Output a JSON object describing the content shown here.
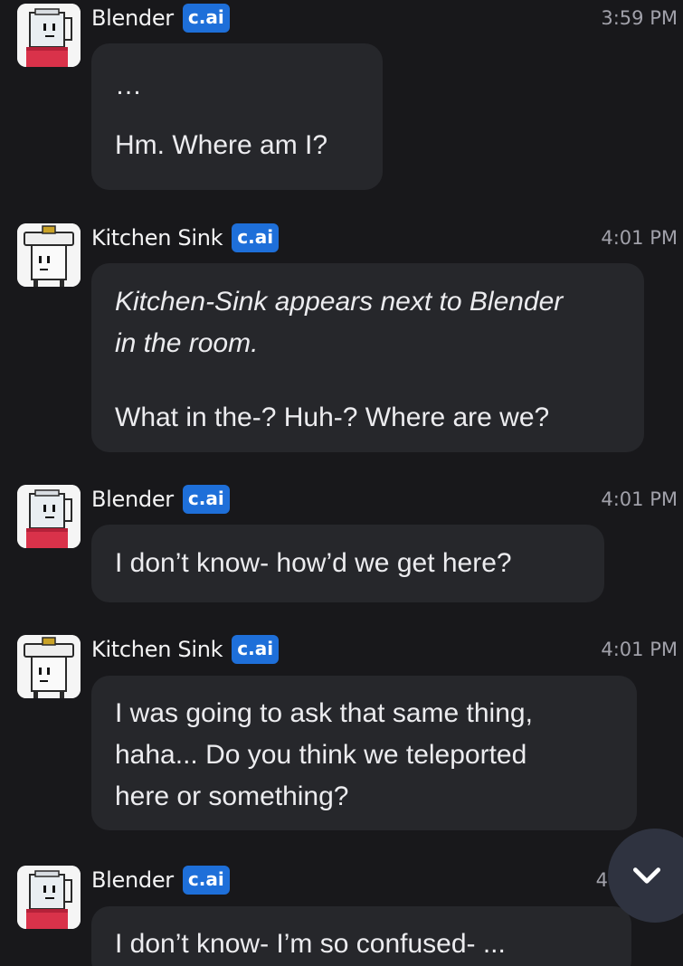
{
  "badge_label": "c.ai",
  "messages": [
    {
      "sender": "Blender",
      "time": "3:59 PM",
      "avatar_icon": "blender-avatar-icon",
      "lines": [
        "…",
        "Hm. Where am I?"
      ]
    },
    {
      "sender": "Kitchen Sink",
      "time": "4:01 PM",
      "avatar_icon": "kitchen-sink-avatar-icon",
      "action_lines": [
        "Kitchen-Sink appears next to Blender",
        "in the room."
      ],
      "lines": [
        "What in the-? Huh-? Where are we?"
      ]
    },
    {
      "sender": "Blender",
      "time": "4:01 PM",
      "avatar_icon": "blender-avatar-icon",
      "lines": [
        "I don’t know- how’d we get here?"
      ]
    },
    {
      "sender": "Kitchen Sink",
      "time": "4:01 PM",
      "avatar_icon": "kitchen-sink-avatar-icon",
      "lines": [
        "I was going to ask that same thing,",
        "haha... Do you think we teleported",
        "here or something?"
      ]
    },
    {
      "sender": "Blender",
      "time": "4:",
      "avatar_icon": "blender-avatar-icon",
      "lines": [
        "I don’t know- I’m so confused- ..."
      ]
    }
  ],
  "scroll_button": {
    "icon": "chevron-down-icon"
  },
  "colors": {
    "background": "#18181b",
    "bubble": "#26272b",
    "badge": "#1e6fd9",
    "timestamp": "#a1a1aa"
  }
}
